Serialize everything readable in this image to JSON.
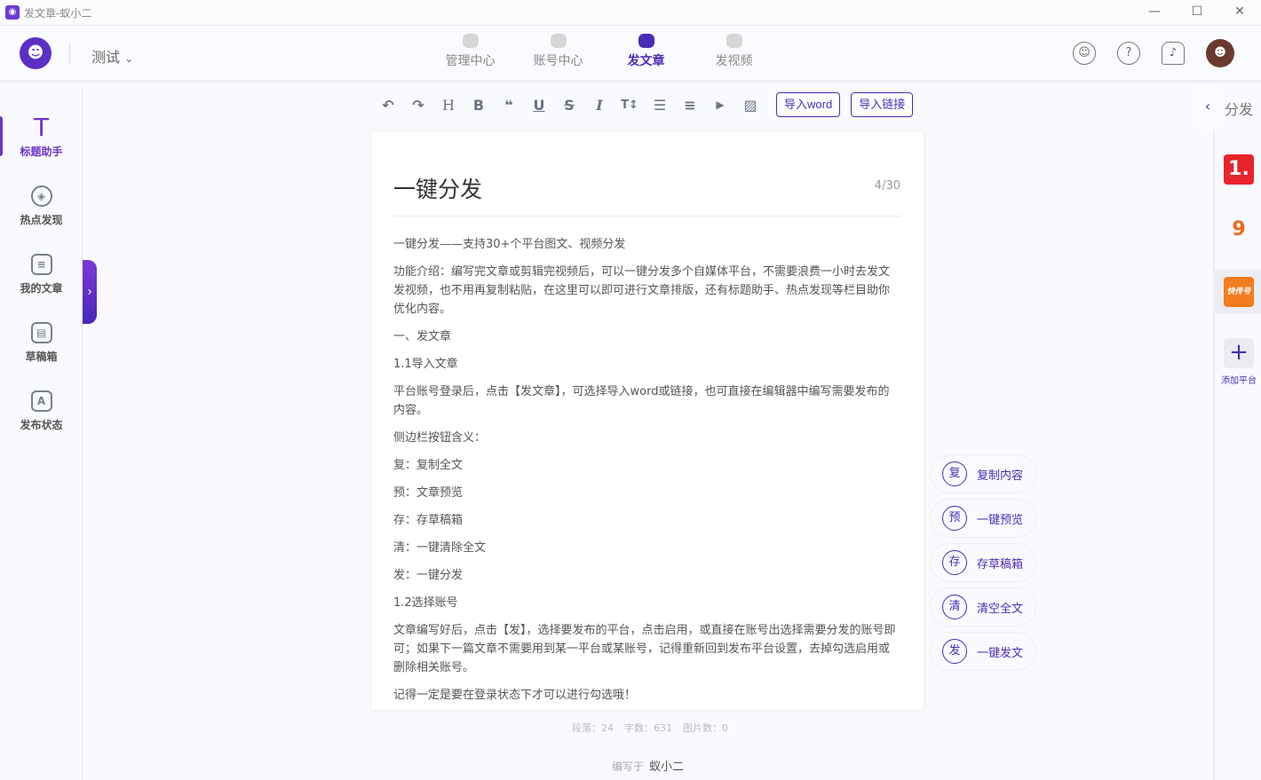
{
  "window": {
    "title": "发文章-蚁小二",
    "icon": "app-logo-icon",
    "controls": [
      "—",
      "☐",
      "✕"
    ]
  },
  "header": {
    "workspace": "测试",
    "nav": [
      {
        "label": "管理中心",
        "icon": "monitor-icon"
      },
      {
        "label": "账号中心",
        "icon": "account-icon"
      },
      {
        "label": "发文章",
        "icon": "article-icon",
        "active": true
      },
      {
        "label": "发视频",
        "icon": "video-icon"
      }
    ],
    "icons": [
      "robot-icon",
      "help-icon",
      "bell-icon",
      "avatar"
    ]
  },
  "sidebar": {
    "items": [
      {
        "label": "标题助手",
        "glyph": "T",
        "active": true
      },
      {
        "label": "热点发现",
        "glyph": "◈"
      },
      {
        "label": "我的文章",
        "glyph": "≡"
      },
      {
        "label": "草稿箱",
        "glyph": "▤"
      },
      {
        "label": "发布状态",
        "glyph": "A"
      }
    ]
  },
  "toolbar": {
    "tools": [
      {
        "g": "↶",
        "n": "undo-icon"
      },
      {
        "g": "↷",
        "n": "redo-icon"
      },
      {
        "g": "H",
        "n": "heading-icon"
      },
      {
        "g": "B",
        "n": "bold-icon"
      },
      {
        "g": "❝",
        "n": "quote-icon"
      },
      {
        "g": "U",
        "n": "underline-icon"
      },
      {
        "g": "S",
        "n": "strikethrough-icon"
      },
      {
        "g": "I",
        "n": "italic-icon"
      },
      {
        "g": "T↕",
        "n": "font-size-icon"
      },
      {
        "g": "☰",
        "n": "list-icon"
      },
      {
        "g": "≡",
        "n": "align-icon"
      },
      {
        "g": "▶",
        "n": "video-insert-icon"
      },
      {
        "g": "▨",
        "n": "image-insert-icon"
      }
    ],
    "import_word": "导入word",
    "import_link": "导入链接"
  },
  "editor": {
    "title": "一键分发",
    "count": "4/30",
    "paragraphs": [
      "一键分发——支持30+个平台图文、视频分发",
      "功能介绍：编写完文章或剪辑完视频后，可以一键分发多个自媒体平台，不需要浪费一小时去发文发视频，也不用再复制粘贴，在这里可以即可进行文章排版，还有标题助手、热点发现等栏目助你优化内容。",
      "一、发文章",
      "1.1导入文章",
      "平台账号登录后，点击【发文章】，可选择导入word或链接，也可直接在编辑器中编写需要发布的内容。",
      "侧边栏按钮含义：",
      "复：复制全文",
      "预：文章预览",
      "存：存草稿箱",
      "清：一键清除全文",
      "发：一键分发",
      "1.2选择账号",
      "文章编写好后，点击【发】，选择要发布的平台，点击启用，或直接在账号出选择需要分发的账号即可；如果下一篇文章不需要用到某一平台或某账号，记得重新回到发布平台设置，去掉勾选启用或删除相关账号。",
      "记得一定是要在登录状态下才可以进行勾选哦！"
    ]
  },
  "stats": {
    "paragraphs": "段落：24",
    "chars": "字数：631",
    "images": "图片数：0"
  },
  "author": {
    "label": "编写于",
    "name": "蚁小二"
  },
  "actions": [
    {
      "c": "复",
      "label": "复制内容"
    },
    {
      "c": "预",
      "label": "一键预览"
    },
    {
      "c": "存",
      "label": "存草稿箱"
    },
    {
      "c": "清",
      "label": "清空全文"
    },
    {
      "c": "发",
      "label": "一键发文"
    }
  ],
  "right_panel": {
    "title": "分发",
    "platforms": [
      {
        "text": "1.",
        "color": "#e8242c"
      },
      {
        "text": "9",
        "color": "#ffffff"
      },
      {
        "text": "快传号",
        "color": "#f57c1f"
      }
    ],
    "add_label": "添加平台"
  }
}
